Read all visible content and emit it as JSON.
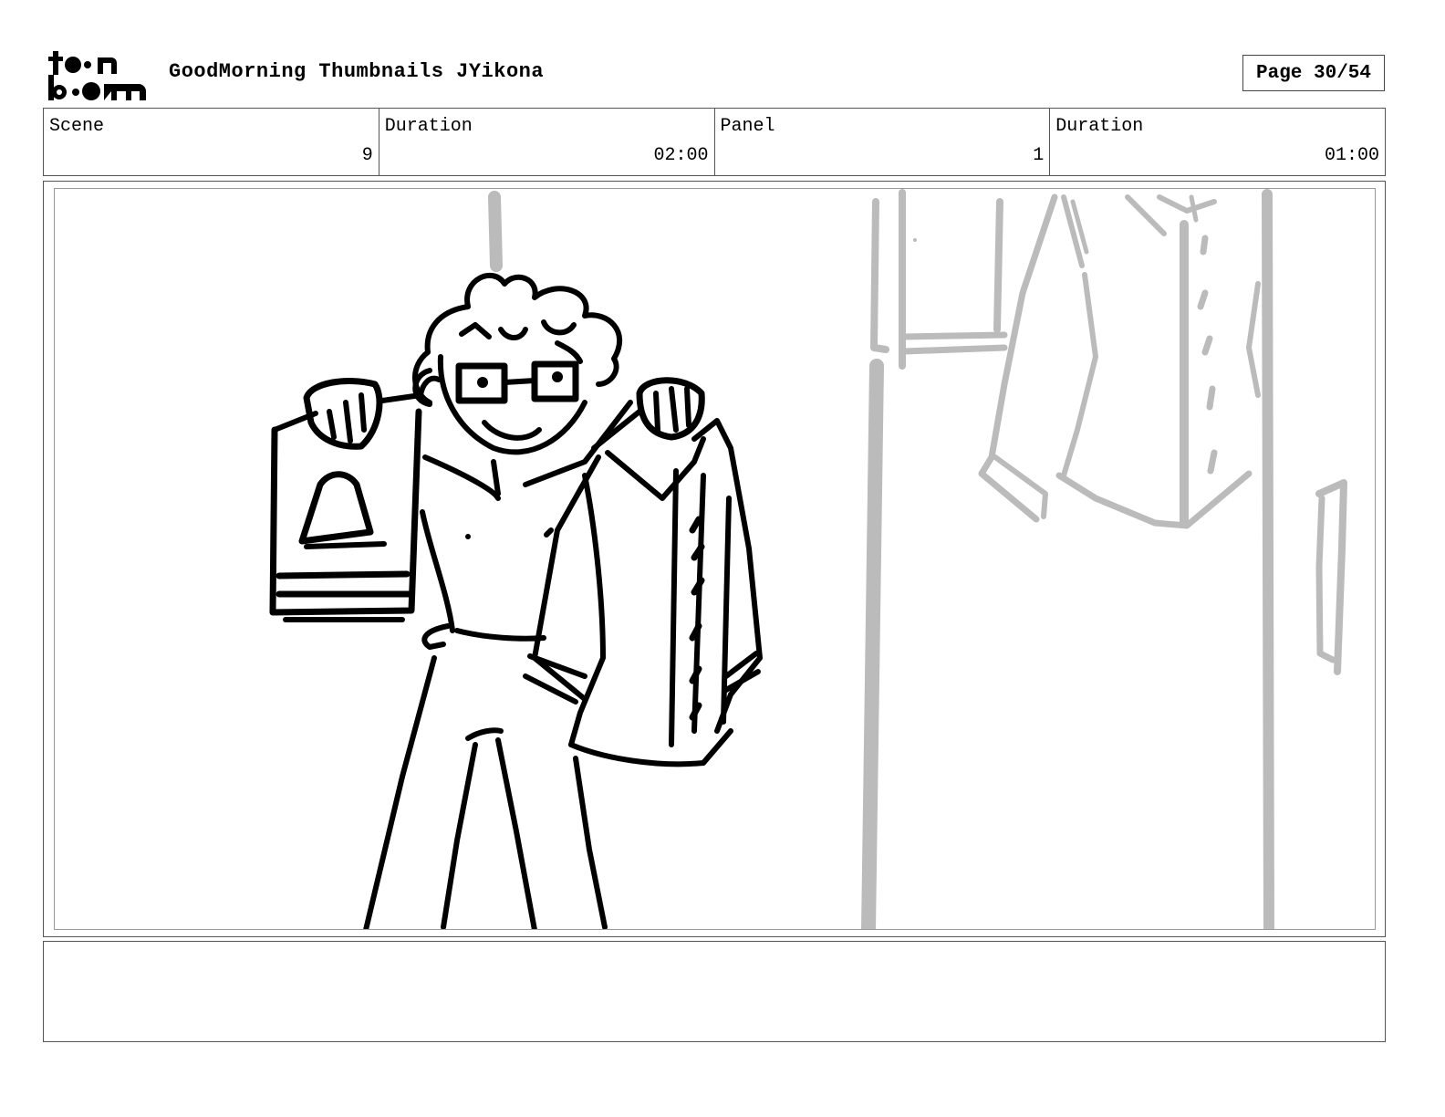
{
  "header": {
    "logo_text": "toon boom",
    "title": "GoodMorning Thumbnails JYikona",
    "page": "Page 30/54"
  },
  "info": {
    "scene_label": "Scene",
    "scene_value": "9",
    "scene_duration_label": "Duration",
    "scene_duration_value": "02:00",
    "panel_label": "Panel",
    "panel_value": "1",
    "panel_duration_label": "Duration",
    "panel_duration_value": "01:00"
  },
  "notes": {
    "text": ""
  }
}
